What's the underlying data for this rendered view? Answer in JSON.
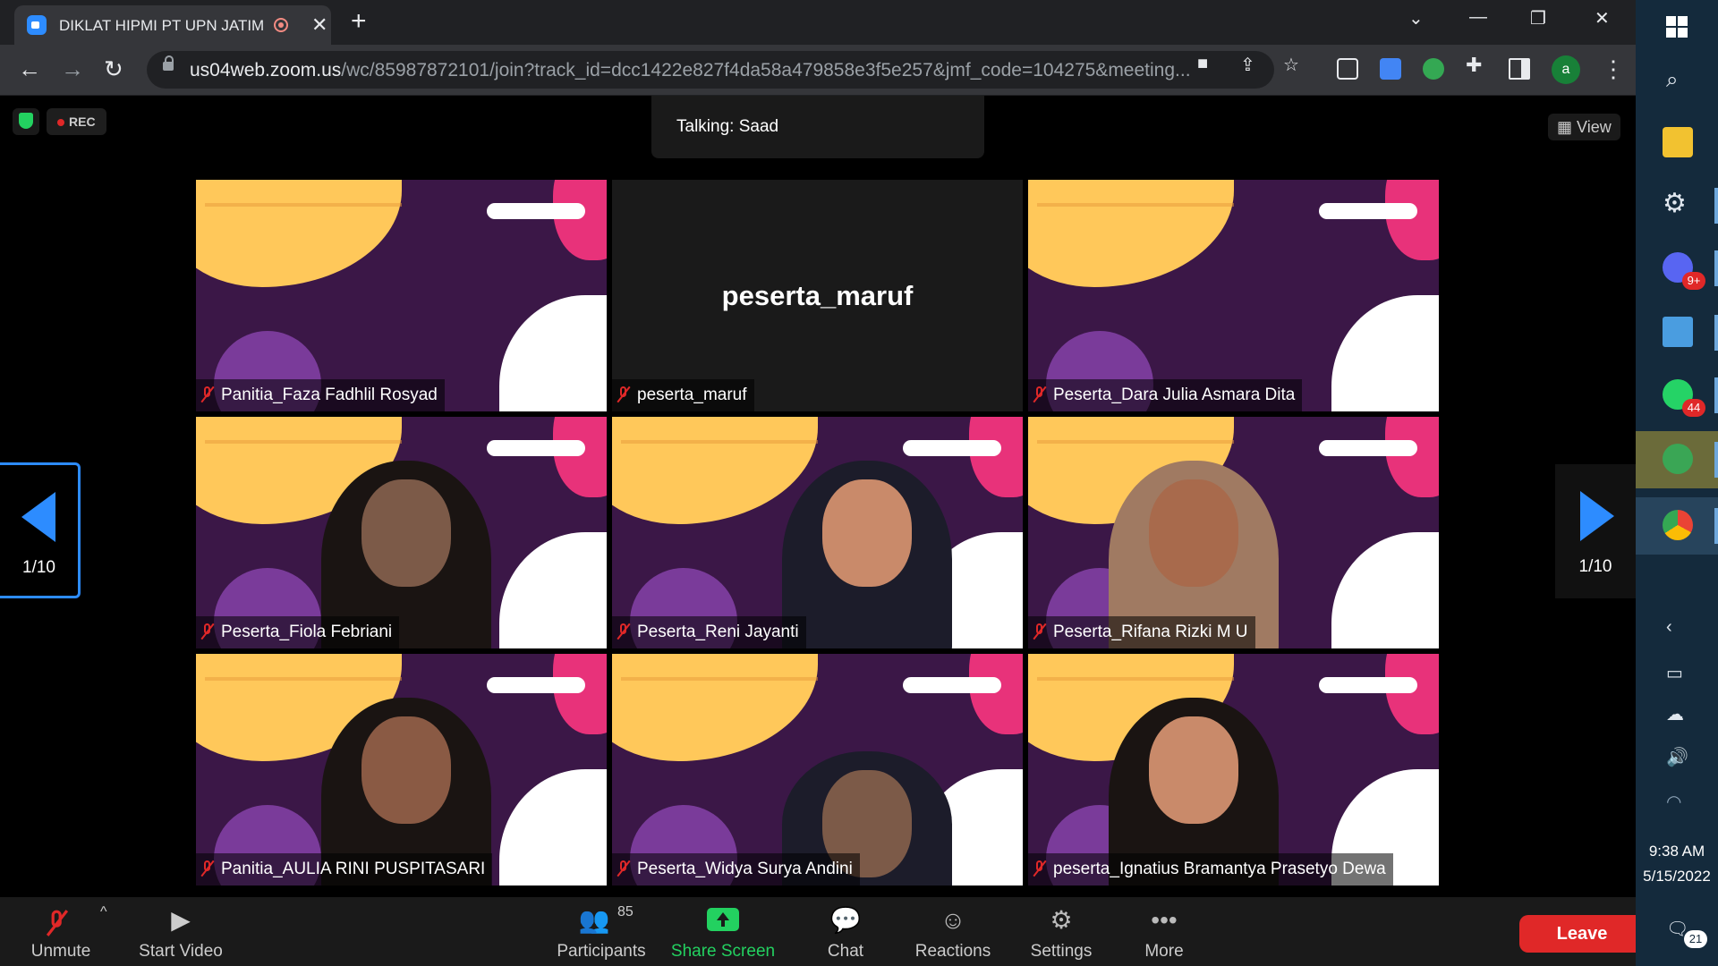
{
  "browser": {
    "tab": {
      "title": "DIKLAT HIPMI PT UPN JATIM"
    },
    "url": {
      "host": "us04web.zoom.us",
      "path": "/wc/85987872101/join?track_id=dcc1422e827f4da58a479858e3f5e257&jmf_code=104275&meeting..."
    },
    "profile_initial": "a"
  },
  "zoom": {
    "rec_label": "REC",
    "talking": "Talking: Saad",
    "view_label": "View",
    "page_left": "1/10",
    "page_right": "1/10",
    "tiles": [
      {
        "name": "Panitia_Faza Fadhlil Rosyad",
        "video": true
      },
      {
        "name": "peserta_maruf",
        "video": false,
        "display_name": "peserta_maruf"
      },
      {
        "name": "Peserta_Dara Julia Asmara Dita",
        "video": true
      },
      {
        "name": "Peserta_Fiola Febriani",
        "video": true
      },
      {
        "name": "Peserta_Reni Jayanti",
        "video": true
      },
      {
        "name": "Peserta_Rifana Rizki M U",
        "video": true
      },
      {
        "name": "Panitia_AULIA RINI PUSPITASARI",
        "video": true
      },
      {
        "name": "Peserta_Widya Surya Andini",
        "video": true
      },
      {
        "name": "peserta_Ignatius Bramantya Prasetyo Dewa",
        "video": true
      }
    ],
    "footer": {
      "unmute": "Unmute",
      "start_video": "Start Video",
      "participants": "Participants",
      "participants_count": "85",
      "share_screen": "Share Screen",
      "chat": "Chat",
      "reactions": "Reactions",
      "settings": "Settings",
      "more": "More",
      "leave": "Leave"
    }
  },
  "taskbar": {
    "badges": {
      "discord": "9+",
      "whatsapp": "44",
      "notifications": "21"
    },
    "time": "9:38 AM",
    "date": "5/15/2022"
  },
  "colors": {
    "zoom_blue": "#2d8cff",
    "zoom_green": "#23d160",
    "leave_red": "#e02828",
    "taskbar": "#142a3c"
  }
}
